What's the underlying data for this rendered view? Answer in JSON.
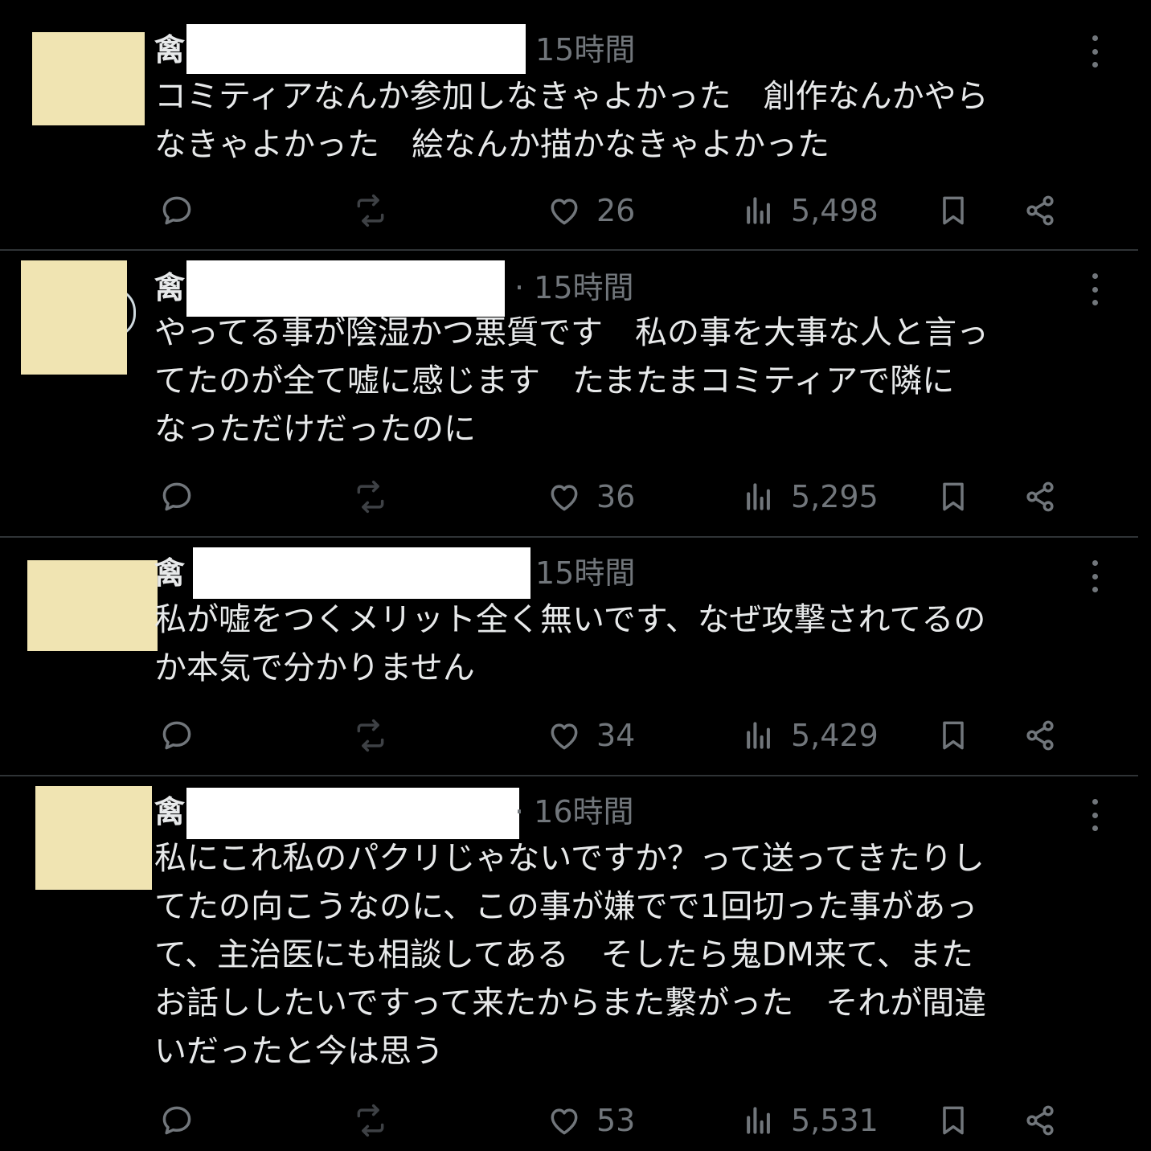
{
  "posts": [
    {
      "name_prefix": "禽",
      "time": "15時間",
      "lines": [
        "コミティアなんか参加しなきゃよかった　創作なんかやら",
        "なきゃよかった　絵なんか描かなきゃよかった"
      ],
      "likes": "26",
      "views": "5,498"
    },
    {
      "name_prefix": "禽",
      "time": "· 15時間",
      "lines": [
        "やってる事が陰湿かつ悪質です　私の事を大事な人と言っ",
        "てたのが全て嘘に感じます　たまたまコミティアで隣に",
        "なっただけだったのに"
      ],
      "likes": "36",
      "views": "5,295"
    },
    {
      "name_prefix": "禽",
      "time": "15時間",
      "lines": [
        "私が嘘をつくメリット全く無いです、なぜ攻撃されてるの",
        "か本気で分かりません"
      ],
      "likes": "34",
      "views": "5,429"
    },
    {
      "name_prefix": "禽",
      "time": "· 16時間",
      "lines": [
        "私にこれ私のパクリじゃないですか？って送ってきたりし",
        "てたの向こうなのに、この事が嫌でで1回切った事があっ",
        "て、主治医にも相談してある　そしたら鬼DM来て、また",
        "お話ししたいですって来たからまた繋がった　それが間違",
        "いだったと今は思う"
      ],
      "likes": "53",
      "views": "5,531"
    }
  ],
  "icons": {
    "reply": "reply-icon",
    "repost": "repost-icon",
    "like": "heart-icon",
    "views": "views-icon",
    "bookmark": "bookmark-icon",
    "share": "share-icon",
    "more": "more-icon"
  },
  "colors": {
    "background": "#000000",
    "text": "#e7e9ea",
    "muted": "#71767b",
    "repost_muted": "#3e4145",
    "divider": "#2f3336",
    "avatar_placeholder": "#f0e4b2",
    "redaction": "#ffffff"
  }
}
